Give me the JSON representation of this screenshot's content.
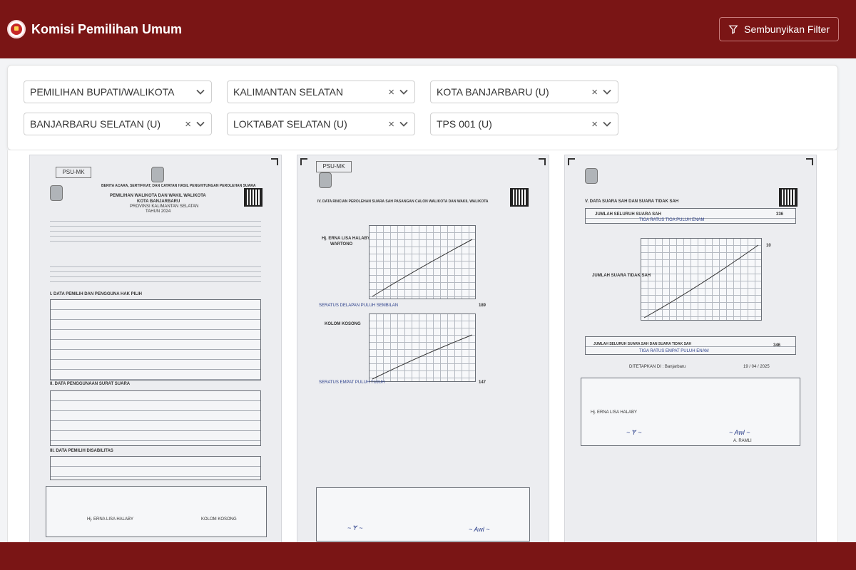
{
  "header": {
    "title": "Komisi Pemilihan Umum",
    "filter_button_label": "Sembunyikan Filter"
  },
  "filters": [
    {
      "value": "PEMILIHAN BUPATI/WALIKOTA",
      "clearable": false
    },
    {
      "value": "KALIMANTAN SELATAN",
      "clearable": true
    },
    {
      "value": "KOTA BANJARBARU (U)",
      "clearable": true
    },
    {
      "value": "BANJARBARU SELATAN (U)",
      "clearable": true
    },
    {
      "value": "LOKTABAT SELATAN (U)",
      "clearable": true
    },
    {
      "value": "TPS 001 (U)",
      "clearable": true
    }
  ],
  "icons": {
    "clear": "×",
    "filter": "funnel-icon",
    "chevron": "chevron-down-icon"
  },
  "documents": [
    {
      "code": "PSU-MK",
      "title": "BERITA ACARA, SERTIFIKAT, DAN CATATAN HASIL PENGHITUNGAN PEROLEHAN SUARA",
      "subtitle": "PEMILIHAN WALIKOTA DAN WAKIL WALIKOTA",
      "city": "KOTA BANJARBARU",
      "province": "PROVINSI KALIMANTAN SELATAN",
      "year": "TAHUN 2024",
      "section_i": "I. DATA PEMILIH DAN PENGGUNA HAK PILIH",
      "section_ii": "II. DATA PENGGUNAAN SURAT SUARA",
      "section_iii": "III. DATA PEMILIH DISABILITAS",
      "sig_name_left": "Hj. ERNA LISA HALABY",
      "sig_name_right": "KOLOM KOSONG"
    },
    {
      "code": "PSU-MK",
      "section": "IV. DATA RINCIAN PEROLEHAN SUARA SAH PASANGAN CALON WALIKOTA DAN WAKIL WALIKOTA",
      "candidate_1": "Hj. ERNA LISA HALABY",
      "candidate_1_sub": "WARTONO",
      "candidate_2": "KOLOM KOSONG",
      "total_1_words": "SERATUS DELAPAN PULUH SEMBILAN",
      "total_1": "189",
      "total_2_words": "SERATUS EMPAT PULUH TUJUH",
      "total_2": "147"
    },
    {
      "section": "V. DATA SUARA SAH DAN SUARA TIDAK SAH",
      "row_a": "JUMLAH SELURUH SUARA SAH",
      "row_a_words": "TIGA RATUS TIGA PULUH ENAM",
      "row_a_value": "336",
      "row_b": "JUMLAH SUARA TIDAK SAH",
      "row_b_value": "10",
      "row_c": "JUMLAH SELURUH SUARA SAH DAN SUARA TIDAK SAH",
      "row_c_words": "TIGA RATUS EMPAT PULUH ENAM",
      "row_c_value": "346",
      "place": "DITETAPKAN DI : Banjarbaru",
      "date": "19 / 04 / 2025",
      "sig_left": "Hj. ERNA LISA HALABY",
      "sig_right": "A. RAMLI"
    }
  ]
}
